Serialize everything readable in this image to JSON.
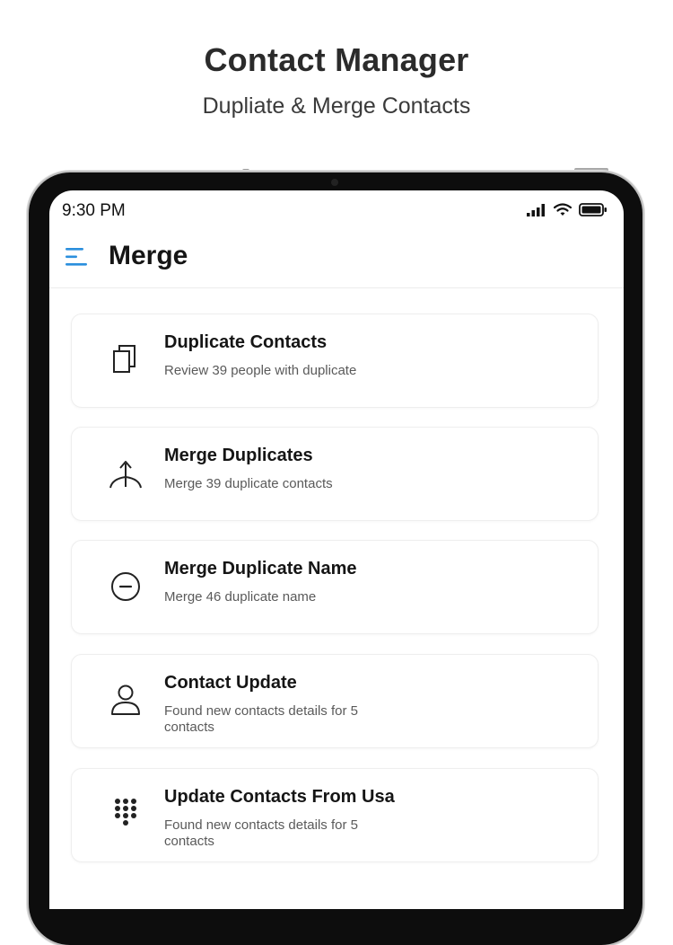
{
  "promo": {
    "title": "Contact Manager",
    "subtitle": "Dupliate & Merge Contacts"
  },
  "status_bar": {
    "time": "9:30 PM",
    "icons": [
      "signal-icon",
      "wifi-icon",
      "battery-icon"
    ]
  },
  "app_bar": {
    "menu_icon": "menu-icon",
    "title": "Merge",
    "accent_color": "#2b8fdd"
  },
  "cards": [
    {
      "icon": "duplicate-icon",
      "title": "Duplicate Contacts",
      "subtitle": "Review 39 people with duplicate"
    },
    {
      "icon": "merge-icon",
      "title": "Merge Duplicates",
      "subtitle": "Merge 39 duplicate contacts"
    },
    {
      "icon": "minus-circle-icon",
      "title": "Merge Duplicate Name",
      "subtitle": "Merge 46 duplicate name"
    },
    {
      "icon": "person-icon",
      "title": "Contact Update",
      "subtitle": "Found new contacts details for 5 contacts"
    },
    {
      "icon": "dialpad-icon",
      "title": "Update Contacts From Usa",
      "subtitle": "Found new contacts details for 5 contacts"
    }
  ]
}
